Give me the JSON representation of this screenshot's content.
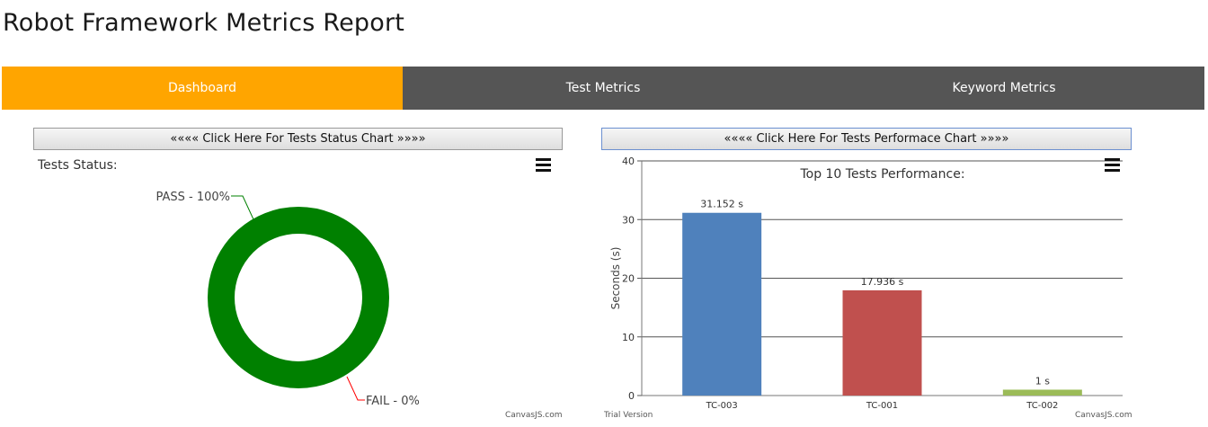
{
  "page": {
    "title": "Robot Framework Metrics Report"
  },
  "nav": {
    "tabs": [
      {
        "label": "Dashboard",
        "active": true
      },
      {
        "label": "Test Metrics",
        "active": false
      },
      {
        "label": "Keyword Metrics",
        "active": false
      }
    ],
    "active_color": "#FFA500",
    "bar_color": "#555555"
  },
  "status_panel": {
    "button_label": "«««« Click Here For Tests Status Chart »»»»",
    "watermark": "CanvasJS.com"
  },
  "performance_panel": {
    "button_label": "«««« Click Here For Tests Performace Chart »»»»",
    "trial_label": "Trial Version",
    "watermark": "CanvasJS.com"
  },
  "chart_data": [
    {
      "type": "pie",
      "title": "Tests Status:",
      "labels": [
        "PASS",
        "FAIL"
      ],
      "values": [
        100,
        0
      ],
      "display_labels": [
        "PASS - 100%",
        "FAIL - 0%"
      ],
      "colors": [
        "#008000",
        "#ff0000"
      ]
    },
    {
      "type": "bar",
      "title": "Top 10 Tests Performance:",
      "ylabel": "Seconds (s)",
      "xlabel": "",
      "categories": [
        "TC-003",
        "TC-001",
        "TC-002"
      ],
      "values": [
        31.152,
        17.936,
        1
      ],
      "data_labels": [
        "31.152 s",
        "17.936 s",
        "1 s"
      ],
      "colors": [
        "#4F81BC",
        "#C0504E",
        "#9BBB58"
      ],
      "ylim": [
        0,
        40
      ],
      "yticks": [
        0,
        10,
        20,
        30,
        40
      ],
      "grid": true
    }
  ]
}
